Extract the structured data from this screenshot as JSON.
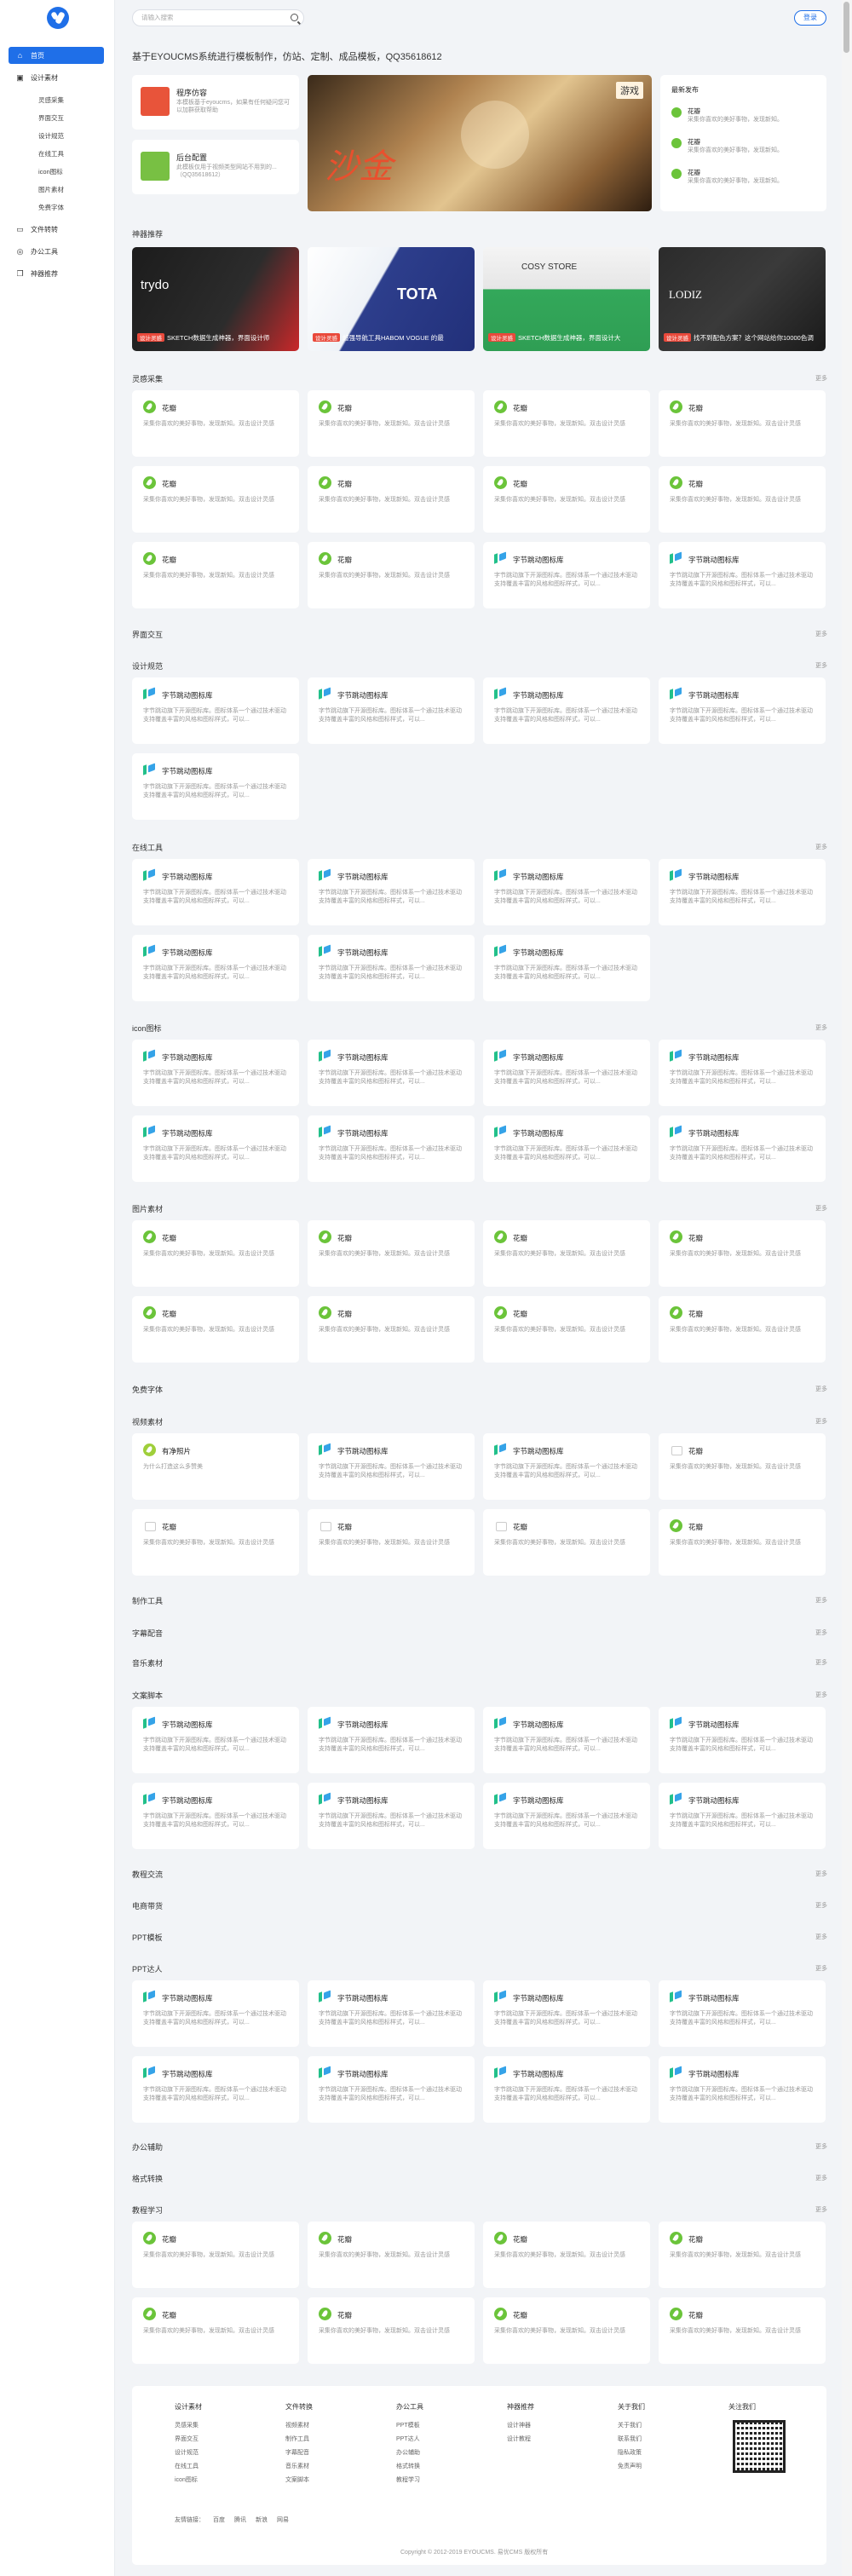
{
  "sidebar": {
    "items": [
      {
        "label": "首页",
        "icon": "home-icon",
        "glyph": "⌂"
      },
      {
        "label": "设计素材",
        "icon": "image-icon",
        "glyph": "▣"
      },
      {
        "label": "文件转转",
        "icon": "file-icon",
        "glyph": "▭"
      },
      {
        "label": "办公工具",
        "icon": "tool-icon",
        "glyph": "◎"
      },
      {
        "label": "神器推荐",
        "icon": "cube-icon",
        "glyph": "❐"
      }
    ],
    "subitems": [
      "灵感采集",
      "界面交互",
      "设计规范",
      "在线工具",
      "icon图标",
      "图片素材",
      "免费字体"
    ]
  },
  "header": {
    "search_placeholder": "请输入搜索",
    "login_label": "登录"
  },
  "notice": "基于EYOUCMS系统进行模板制作，仿站、定制、成品模板，QQ35618612",
  "top_cards": [
    {
      "title": "程序仿容",
      "desc": "本模板基于eyoucms，如果有任何疑问您可以加群获取帮助"
    },
    {
      "title": "后台配置",
      "desc": "此模板仅用于视频类型网站不用到的...（QQ35618612）"
    }
  ],
  "hero": {
    "tag": "游戏",
    "title_art": "沙金"
  },
  "latest": {
    "title": "最新发布",
    "items": [
      {
        "title": "花瓣",
        "desc": "采集你喜欢的美好事物，发现新知。"
      },
      {
        "title": "花瓣",
        "desc": "采集你喜欢的美好事物，发现新知。"
      },
      {
        "title": "花瓣",
        "desc": "采集你喜欢的美好事物，发现新知。"
      }
    ]
  },
  "recommend": {
    "title": "神器推荐",
    "tiles": [
      {
        "tag": "设计灵感",
        "caption": "SKETCH数据生成神器，界面设计师",
        "brand": "trydo"
      },
      {
        "tag": "设计灵感",
        "caption": "超强导航工具HABOM VOGUE 的最",
        "brand": "TOTA"
      },
      {
        "tag": "设计灵感",
        "caption": "SKETCH数据生成神器，界面设计大",
        "brand": "COSY STORE"
      },
      {
        "tag": "设计灵感",
        "caption": "找不到配色方案？这个网站给你10000色调",
        "brand": "LODIZ"
      }
    ]
  },
  "cards": {
    "hb": {
      "title": "花瓣",
      "desc": "采集你喜欢的美好事物，发现新知。双击设计灵感"
    },
    "zj": {
      "title": "字节跳动图标库",
      "desc": "字节跳动旗下开源图标库。图标体系一个通过技术驱动支持覆盖丰富的风格和图标样式，可以..."
    },
    "yj": {
      "title": "有净照片",
      "desc": "为什么打造这么多赞美"
    }
  },
  "sections": [
    {
      "title": "灵感采集",
      "more": "更多"
    },
    {
      "title": "界面交互",
      "more": "更多"
    },
    {
      "title": "设计规范",
      "more": "更多"
    },
    {
      "title": "在线工具",
      "more": "更多"
    },
    {
      "title": "icon图标",
      "more": "更多"
    },
    {
      "title": "图片素材",
      "more": "更多"
    },
    {
      "title": "免费字体",
      "more": "更多"
    },
    {
      "title": "视频素材",
      "more": "更多"
    },
    {
      "title": "制作工具",
      "more": "更多"
    },
    {
      "title": "字幕配音",
      "more": "更多"
    },
    {
      "title": "音乐素材",
      "more": "更多"
    },
    {
      "title": "文案脚本",
      "more": "更多"
    },
    {
      "title": "教程交流",
      "more": "更多"
    },
    {
      "title": "电商带货",
      "more": "更多"
    },
    {
      "title": "PPT模板",
      "more": "更多"
    },
    {
      "title": "PPT达人",
      "more": "更多"
    },
    {
      "title": "办公辅助",
      "more": "更多"
    },
    {
      "title": "格式转换",
      "more": "更多"
    },
    {
      "title": "教程学习",
      "more": "更多"
    }
  ],
  "footer": {
    "columns": [
      {
        "title": "设计素材",
        "links": [
          "灵感采集",
          "界面交互",
          "设计规范",
          "在线工具",
          "icon图标"
        ]
      },
      {
        "title": "文件转换",
        "links": [
          "视频素材",
          "制作工具",
          "字幕配音",
          "音乐素材",
          "文案脚本"
        ]
      },
      {
        "title": "办公工具",
        "links": [
          "PPT模板",
          "PPT达人",
          "办公辅助",
          "格式转换",
          "教程学习"
        ]
      },
      {
        "title": "神器推荐",
        "links": [
          "设计神器",
          "设计教程"
        ]
      },
      {
        "title": "关于我们",
        "links": [
          "关于我们",
          "联系我们",
          "隐私政策",
          "免责声明"
        ]
      },
      {
        "title": "关注我们",
        "links": []
      }
    ],
    "friend_label": "友情链接：",
    "friend_links": [
      "百度",
      "腾讯",
      "新浪",
      "网易"
    ],
    "copyright": "Copyright © 2012-2019 EYOUCMS. 易优CMS 版权所有"
  },
  "colors": {
    "accent": "#1f6fe8",
    "green": "#6bc43a"
  }
}
